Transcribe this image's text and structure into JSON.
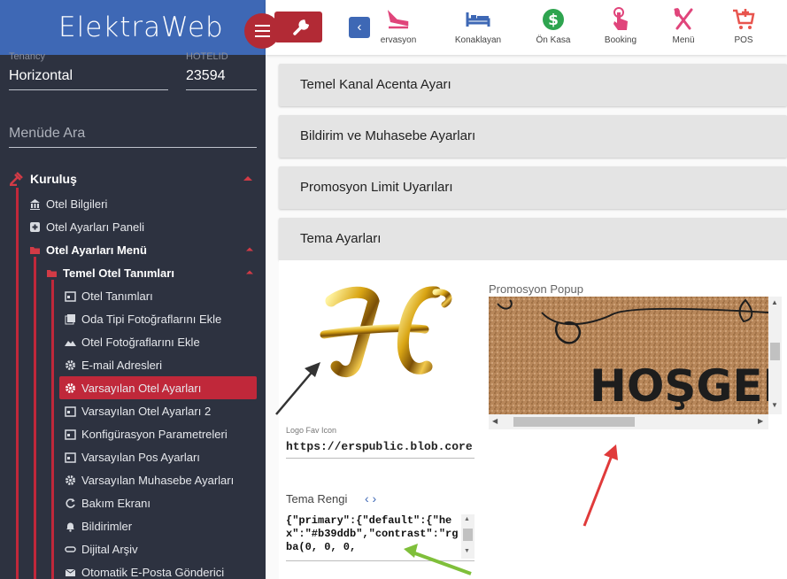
{
  "app": {
    "brand": "ElektraWeb"
  },
  "sidebar": {
    "tenancy_label": "Tenancy",
    "tenancy_value": "Horizontal",
    "hotel_label": "HOTELID",
    "hotel_value": "23594",
    "search_placeholder": "Menüde Ara",
    "items": [
      {
        "label": "Kuruluş",
        "icon": "gavel-icon"
      },
      {
        "label": "Otel Bilgileri",
        "icon": "bank-icon"
      },
      {
        "label": "Otel Ayarları Paneli",
        "icon": "plus-box-icon"
      },
      {
        "label": "Otel Ayarları Menü",
        "icon": "folder-open-icon"
      },
      {
        "label": "Temel Otel Tanımları",
        "icon": "folder-open-icon"
      },
      {
        "label": "Otel Tanımları",
        "icon": "calendar-icon"
      },
      {
        "label": "Oda Tipi Fotoğraflarını Ekle",
        "icon": "gallery-icon"
      },
      {
        "label": "Otel Fotoğraflarını Ekle",
        "icon": "mountain-icon"
      },
      {
        "label": "E-mail Adresleri",
        "icon": "gear-icon"
      },
      {
        "label": "Varsayılan Otel Ayarları",
        "icon": "gear-icon"
      },
      {
        "label": "Varsayılan Otel Ayarları 2",
        "icon": "calendar-icon"
      },
      {
        "label": "Konfigürasyon Parametreleri",
        "icon": "calendar-icon"
      },
      {
        "label": "Varsayılan Pos Ayarları",
        "icon": "calendar-icon"
      },
      {
        "label": "Varsayılan Muhasebe Ayarları",
        "icon": "gear-icon"
      },
      {
        "label": "Bakım Ekranı",
        "icon": "refresh-icon"
      },
      {
        "label": "Bildirimler",
        "icon": "bell-icon"
      },
      {
        "label": "Dijital Arşiv",
        "icon": "link-icon"
      },
      {
        "label": "Otomatik E-Posta Gönderici",
        "icon": "mail-icon"
      }
    ]
  },
  "toolbar": {
    "items": [
      {
        "label": "ervasyon",
        "icon": "plane-landing-icon",
        "color": "#e0457b"
      },
      {
        "label": "Konaklayan",
        "icon": "bed-icon",
        "color": "#3e68b5"
      },
      {
        "label": "Ön Kasa",
        "icon": "dollar-icon",
        "color": "#2ea44f"
      },
      {
        "label": "Booking",
        "icon": "touch-icon",
        "color": "#e0457b"
      },
      {
        "label": "Menü",
        "icon": "utensils-icon",
        "color": "#e0457b"
      },
      {
        "label": "POS",
        "icon": "cart-icon",
        "color": "#e8554e"
      }
    ]
  },
  "panels": [
    {
      "title": "Temel Kanal Acenta Ayarı"
    },
    {
      "title": "Bildirim ve Muhasebe Ayarları"
    },
    {
      "title": "Promosyon Limit Uyarıları"
    },
    {
      "title": "Tema Ayarları"
    }
  ],
  "theme": {
    "logo_fav_label": "Logo Fav Icon",
    "logo_fav_value": "https://erspublic.blob.core.windows.net",
    "tema_rengi_label": "Tema Rengi",
    "tema_rengi_value": "{\"primary\":{\"default\":{\"hex\":\"#b39ddb\",\"contrast\":\"rgba(0, 0, 0,",
    "promo_label": "Promosyon Popup",
    "promo_image_text": "HOŞGEL"
  },
  "colors": {
    "sidebar_bg": "#2d3240",
    "brand_bg": "#3e68b5",
    "accent_red": "#c0283a"
  }
}
